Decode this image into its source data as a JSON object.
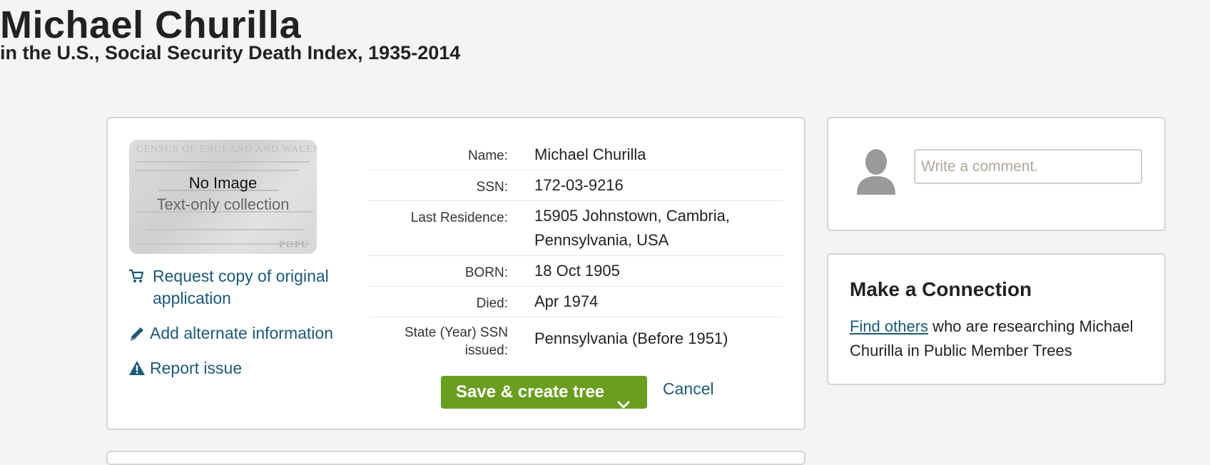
{
  "header": {
    "title": "Michael Churilla",
    "subtitle": "in the U.S., Social Security Death Index, 1935-2014"
  },
  "thumbnail": {
    "no_image": "No Image",
    "text_only": "Text-only collection",
    "doc_heading": "CENSUS OF ENGLAND AND WALES",
    "doc_footer": "POPU"
  },
  "actions": {
    "request_copy": "Request copy of original application",
    "add_alternate": "Add alternate information",
    "report_issue": "Report issue"
  },
  "facts": [
    {
      "label": "Name:",
      "value": "Michael Churilla"
    },
    {
      "label": "SSN:",
      "value": "172-03-9216"
    },
    {
      "label": "Last Residence:",
      "value_line1": "15905 Johnstown, Cambria,",
      "value_line2": "Pennsylvania, USA"
    },
    {
      "label": "BORN:",
      "value": "18 Oct 1905"
    },
    {
      "label": "Died:",
      "value": "Apr 1974"
    },
    {
      "label_line1": "State (Year) SSN",
      "label_line2": "issued:",
      "value": "Pennsylvania (Before 1951)"
    }
  ],
  "buttons": {
    "save": "Save & create tree",
    "cancel": "Cancel"
  },
  "comment": {
    "placeholder": "Write a comment."
  },
  "connection": {
    "title": "Make a Connection",
    "link": "Find others",
    "text": " who are researching Michael Churilla in Public Member Trees"
  },
  "colors": {
    "accent_green": "#6a9e1f",
    "link_blue": "#1a5a78"
  },
  "icons": {
    "request": "cart-icon",
    "add": "pencil-icon",
    "report": "warning-icon",
    "save_dropdown": "chevron-down-icon",
    "avatar": "person-silhouette-icon"
  }
}
